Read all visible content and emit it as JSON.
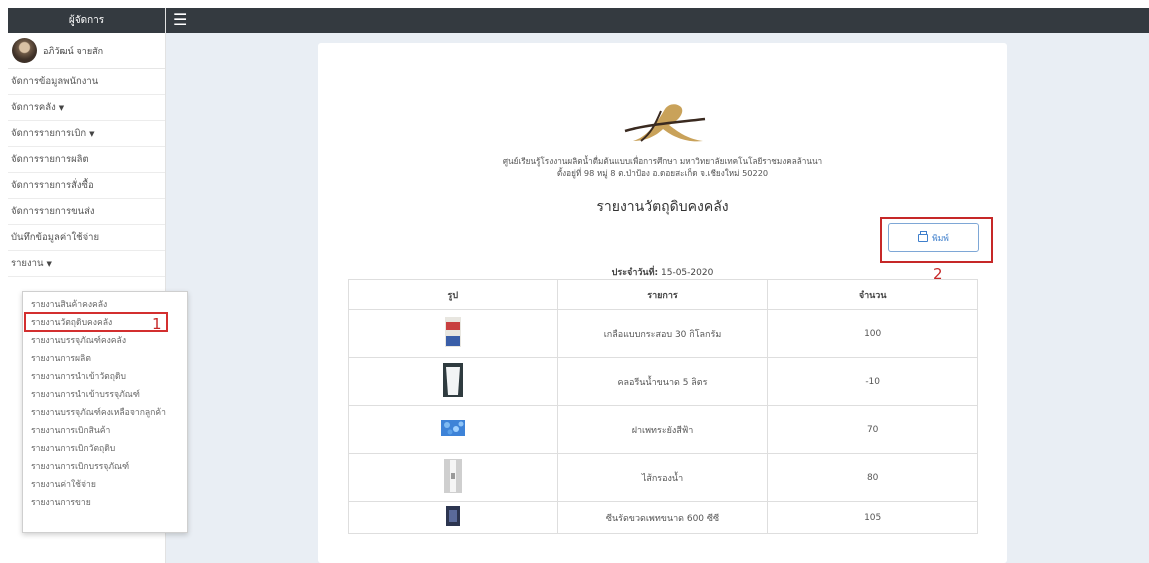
{
  "sidebar": {
    "header": "ผู้จัดการ",
    "user_name": "อภิวัฒน์ จายสัก",
    "items": [
      {
        "label": "จัดการข้อมูลพนักงาน",
        "caret": ""
      },
      {
        "label": "จัดการคลัง",
        "caret": "▼"
      },
      {
        "label": "จัดการรายการเบิก",
        "caret": "▼"
      },
      {
        "label": "จัดการรายการผลิต",
        "caret": ""
      },
      {
        "label": "จัดการรายการสั่งซื้อ",
        "caret": ""
      },
      {
        "label": "จัดการรายการขนส่ง",
        "caret": ""
      },
      {
        "label": "บันทึกข้อมูลค่าใช้จ่าย",
        "caret": ""
      },
      {
        "label": "รายงาน",
        "caret": "▼"
      }
    ]
  },
  "report_menu": {
    "items": [
      "รายงานสินค้าคงคลัง",
      "รายงานวัตถุดิบคงคลัง",
      "รายงานบรรจุภัณฑ์คงคลัง",
      "รายงานการผลิต",
      "รายงานการนำเข้าวัตถุดิบ",
      "รายงานการนำเข้าบรรจุภัณฑ์",
      "รายงานบรรจุภัณฑ์คงเหลือจากลูกค้า",
      "รายงานการเบิกสินค้า",
      "รายงานการเบิกวัตถุดิบ",
      "รายงานการเบิกบรรจุภัณฑ์",
      "รายงานค่าใช้จ่าย",
      "รายงานการขาย"
    ],
    "selected_index": 1
  },
  "annotations": {
    "marker_1": "1",
    "marker_2": "2",
    "marker_color": "#c62828"
  },
  "report": {
    "org_line1": "ศูนย์เรียนรู้โรงงานผลิตน้ำดื่มต้นแบบเพื่อการศึกษา มหาวิทยาลัยเทคโนโลยีราชมงคลล้านนา",
    "org_line2": "ตั้งอยู่ที่ 98 หมู่ 8 ต.ป่าป้อง อ.ดอยสะเก็ด จ.เชียงใหม่ 50220",
    "title": "รายงานวัตถุดิบคงคลัง",
    "print_label": "พิมพ์",
    "date_label": "ประจำวันที่:",
    "date_value": "15-05-2020",
    "columns": [
      "รูป",
      "รายการ",
      "จำนวน"
    ],
    "rows": [
      {
        "image": "salt-bag-image",
        "name": "เกลือแบบกระสอบ 30 กิโลกรัม",
        "qty": "100"
      },
      {
        "image": "chlorine-bucket-image",
        "name": "คลอรีนน้ำขนาด 5 ลิตร",
        "qty": "-10"
      },
      {
        "image": "blue-caps-image",
        "name": "ฝาเพทระยังสีฟ้า",
        "qty": "70"
      },
      {
        "image": "water-filter-image",
        "name": "ไส้กรองน้ำ",
        "qty": "80"
      },
      {
        "image": "shrink-film-image",
        "name": "ซีนรัดขวดเพทขนาด 600 ซีซี",
        "qty": "105"
      }
    ]
  },
  "colors": {
    "dark_bar": "#343a40",
    "main_bg": "#e9eef4",
    "accent_blue": "#3f7fcc"
  }
}
